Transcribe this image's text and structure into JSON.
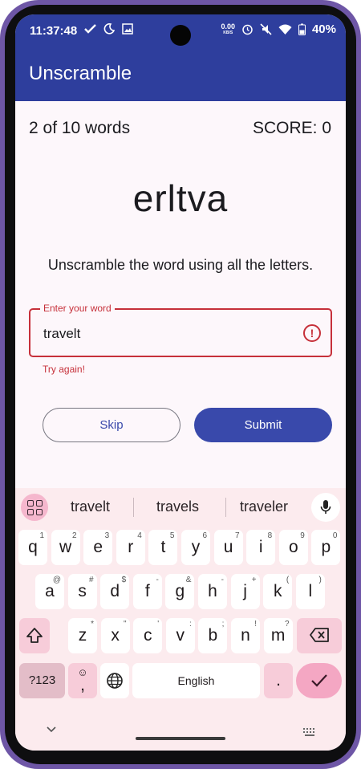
{
  "status_bar": {
    "time": "11:37:48",
    "net_speed": "0.00",
    "net_unit": "KB/S",
    "battery": "40%"
  },
  "app_bar": {
    "title": "Unscramble"
  },
  "game": {
    "counter": "2 of 10 words",
    "score": "SCORE: 0",
    "scrambled_word": "erltva",
    "instructions": "Unscramble the word using all the letters."
  },
  "input": {
    "label": "Enter your word",
    "value": "travelt",
    "error": "Try again!"
  },
  "buttons": {
    "skip": "Skip",
    "submit": "Submit"
  },
  "keyboard": {
    "suggestions": [
      "travelt",
      "travels",
      "traveler"
    ],
    "row1": [
      {
        "k": "q",
        "h": "1"
      },
      {
        "k": "w",
        "h": "2"
      },
      {
        "k": "e",
        "h": "3"
      },
      {
        "k": "r",
        "h": "4"
      },
      {
        "k": "t",
        "h": "5"
      },
      {
        "k": "y",
        "h": "6"
      },
      {
        "k": "u",
        "h": "7"
      },
      {
        "k": "i",
        "h": "8"
      },
      {
        "k": "o",
        "h": "9"
      },
      {
        "k": "p",
        "h": "0"
      }
    ],
    "row2": [
      {
        "k": "a",
        "h": "@"
      },
      {
        "k": "s",
        "h": "#"
      },
      {
        "k": "d",
        "h": "$"
      },
      {
        "k": "f",
        "h": "-"
      },
      {
        "k": "g",
        "h": "&"
      },
      {
        "k": "h",
        "h": "-"
      },
      {
        "k": "j",
        "h": "+"
      },
      {
        "k": "k",
        "h": "("
      },
      {
        "k": "l",
        "h": ")"
      }
    ],
    "row3": [
      {
        "k": "z",
        "h": "*"
      },
      {
        "k": "x",
        "h": "\""
      },
      {
        "k": "c",
        "h": "'"
      },
      {
        "k": "v",
        "h": ":"
      },
      {
        "k": "b",
        "h": ";"
      },
      {
        "k": "n",
        "h": "!"
      },
      {
        "k": "m",
        "h": "?"
      }
    ],
    "symbols_key": "?123",
    "emoji_comma_key": ",",
    "space_label": "English",
    "period_key": "."
  },
  "colors": {
    "primary": "#2e3e9d",
    "button": "#3949ab",
    "error": "#c6303a",
    "keyboard_bg": "#fcebee",
    "frame": "#6e56a6"
  }
}
